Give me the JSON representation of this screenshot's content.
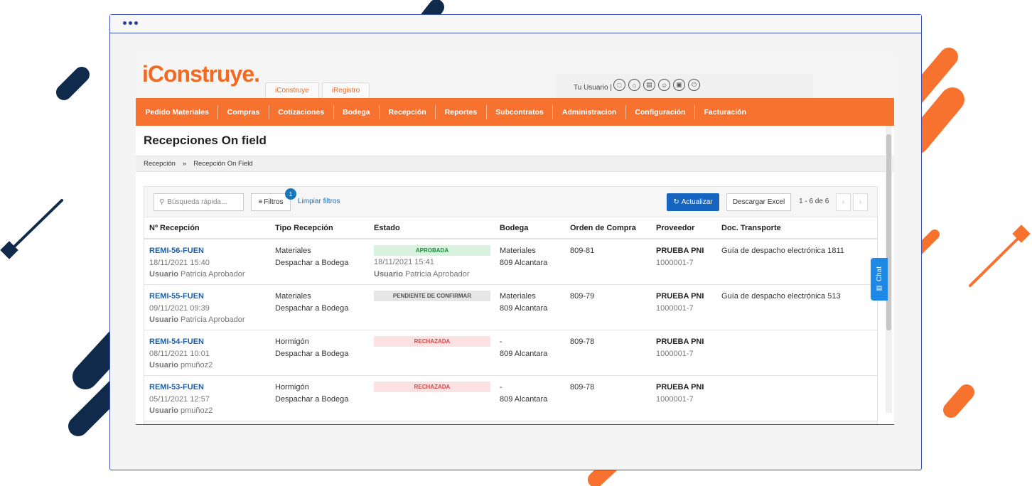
{
  "header": {
    "logo_text": "iConstruye.",
    "tabs": [
      {
        "label": "iConstruye"
      },
      {
        "label": "iRegistro"
      }
    ],
    "user_label": "Tu Usuario |",
    "user_icons": [
      "document-icon",
      "home-icon",
      "printer-icon",
      "user-icon",
      "lock-icon",
      "power-icon"
    ]
  },
  "nav": {
    "items": [
      "Pedido Materiales",
      "Compras",
      "Cotizaciones",
      "Bodega",
      "Recepción",
      "Reportes",
      "Subcontratos",
      "Administracion",
      "Configuración",
      "Facturación"
    ]
  },
  "page": {
    "title": "Recepciones On field",
    "breadcrumb": [
      "Recepción",
      "»",
      "Recepción On Field"
    ]
  },
  "toolbar": {
    "search_placeholder": "Búsqueda rápida...",
    "filters_label": "Filtros",
    "filters_count": "1",
    "clear_filters": "Limpiar filtros",
    "refresh_label": "Actualizar",
    "excel_label": "Descargar Excel",
    "pager_text": "1 - 6 de 6",
    "prev": "‹",
    "next": "›"
  },
  "table": {
    "headers": [
      "Nº Recepción",
      "Tipo Recepción",
      "Estado",
      "Bodega",
      "Orden de Compra",
      "Proveedor",
      "Doc. Transporte"
    ],
    "rows": [
      {
        "id": "REMI-56-FUEN",
        "date": "18/11/2021 15:40",
        "user_prefix": "Usuario",
        "user": "Patricia Aprobador",
        "type1": "Materiales",
        "type2": "Despachar a Bodega",
        "status": "APROBADA",
        "status_kind": "ok",
        "status_date": "18/11/2021 15:41",
        "status_user_prefix": "Usuario",
        "status_user": "Patricia Aprobador",
        "bodega1": "Materiales",
        "bodega2": "809 Alcantara",
        "oc": "809-81",
        "prov": "PRUEBA PNI",
        "prov_id": "1000001-7",
        "doc": "Guía de despacho electrónica 1811"
      },
      {
        "id": "REMI-55-FUEN",
        "date": "09/11/2021 09:39",
        "user_prefix": "Usuario",
        "user": "Patricia Aprobador",
        "type1": "Materiales",
        "type2": "Despachar a Bodega",
        "status": "PENDIENTE DE CONFIRMAR",
        "status_kind": "pending",
        "status_date": "",
        "status_user_prefix": "",
        "status_user": "",
        "bodega1": "Materiales",
        "bodega2": "809 Alcantara",
        "oc": "809-79",
        "prov": "PRUEBA PNI",
        "prov_id": "1000001-7",
        "doc": "Guía de despacho electrónica 513"
      },
      {
        "id": "REMI-54-FUEN",
        "date": "08/11/2021 10:01",
        "user_prefix": "Usuario",
        "user": "pmuñoz2",
        "type1": "Hormigón",
        "type2": "Despachar a Bodega",
        "status": "RECHAZADA",
        "status_kind": "rejected",
        "status_date": "",
        "status_user_prefix": "",
        "status_user": "",
        "bodega1": "-",
        "bodega2": "809 Alcantara",
        "oc": "809-78",
        "prov": "PRUEBA PNI",
        "prov_id": "1000001-7",
        "doc": ""
      },
      {
        "id": "REMI-53-FUEN",
        "date": "05/11/2021 12:57",
        "user_prefix": "Usuario",
        "user": "pmuñoz2",
        "type1": "Hormigón",
        "type2": "Despachar a Bodega",
        "status": "RECHAZADA",
        "status_kind": "rejected",
        "status_date": "",
        "status_user_prefix": "",
        "status_user": "",
        "bodega1": "-",
        "bodega2": "809 Alcantara",
        "oc": "809-78",
        "prov": "PRUEBA PNI",
        "prov_id": "1000001-7",
        "doc": ""
      }
    ]
  },
  "chat": {
    "label": "Chat"
  },
  "colors": {
    "brand_orange": "#f7722f",
    "primary_blue": "#1565c0",
    "navy_decor": "#0f2a4a"
  }
}
